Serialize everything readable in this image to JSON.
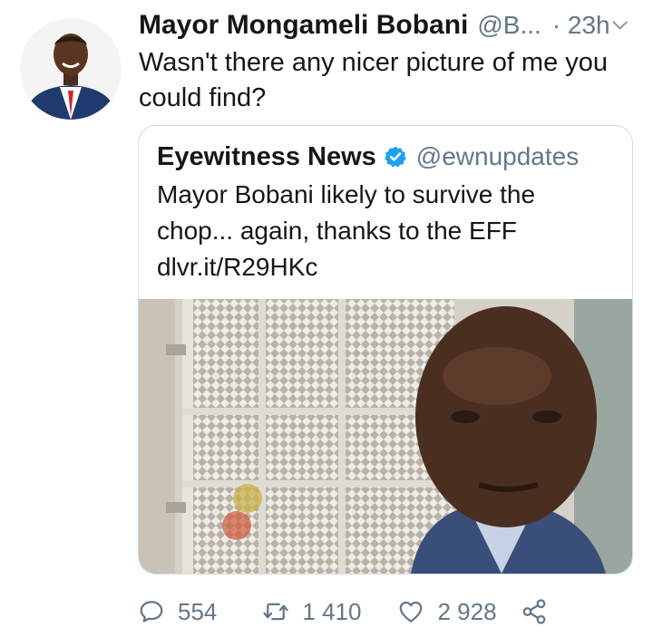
{
  "tweet": {
    "author_name": "Mayor Mongameli Bobani",
    "author_handle": "@B...",
    "time": "· 23h",
    "text": "Wasn't there any nicer picture of me you could find?",
    "avatar_icon": "profile-photo"
  },
  "quoted": {
    "author_name": "Eyewitness News",
    "author_handle": "@ewnupdates",
    "verified_icon": "verified-badge-icon",
    "text_line1": "Mayor Bobani likely to survive the",
    "text_line2": "chop... again, thanks to the EFF",
    "link": "dlvr.it/R29HKc",
    "image_icon": "news-photo"
  },
  "actions": {
    "replies": "554",
    "retweets": "1 410",
    "likes": "2 928"
  },
  "colors": {
    "text": "#14171a",
    "muted": "#657786",
    "verified": "#1da1f2",
    "border": "#d4dbe1"
  }
}
